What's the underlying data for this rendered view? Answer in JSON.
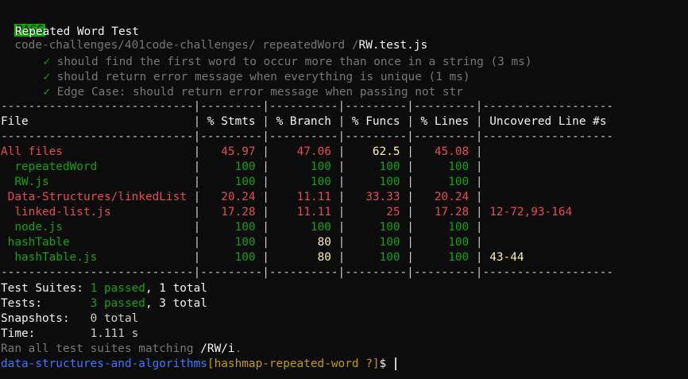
{
  "header": {
    "badge": "PASS",
    "path_dir": "code-challenges/401code-challenges/ repeatedWord /",
    "file": "RW.test.js"
  },
  "suite": {
    "title": "Repeated Word Test",
    "check": "✓",
    "tests": [
      {
        "name": "should find the first word to occur more than once in a string",
        "time": "(3 ms)"
      },
      {
        "name": "should return error message when everything is unique",
        "time": "(1 ms)"
      },
      {
        "name": "Edge Case: should return error message when passing not str",
        "time": ""
      }
    ]
  },
  "coverage": {
    "separator": "----------------------------|---------|----------|---------|---------|-------------------",
    "headers": [
      "File",
      "% Stmts",
      "% Branch",
      "% Funcs",
      "% Lines",
      "Uncovered Line #s"
    ],
    "rows": [
      {
        "file": "All files",
        "indent": 0,
        "stmts": "45.97",
        "branch": "47.06",
        "funcs": "62.5",
        "lines": "45.08",
        "uncovered": "",
        "colors": [
          "red",
          "red",
          "red",
          "yellow",
          "red",
          "red"
        ]
      },
      {
        "file": "repeatedWord",
        "indent": 2,
        "stmts": "100",
        "branch": "100",
        "funcs": "100",
        "lines": "100",
        "uncovered": "",
        "colors": [
          "green",
          "green",
          "green",
          "green",
          "green",
          "green"
        ]
      },
      {
        "file": "RW.js",
        "indent": 2,
        "stmts": "100",
        "branch": "100",
        "funcs": "100",
        "lines": "100",
        "uncovered": "",
        "colors": [
          "green",
          "green",
          "green",
          "green",
          "green",
          "green"
        ]
      },
      {
        "file": "Data-Structures/linkedList",
        "indent": 1,
        "stmts": "20.24",
        "branch": "11.11",
        "funcs": "33.33",
        "lines": "20.24",
        "uncovered": "",
        "colors": [
          "red",
          "red",
          "red",
          "red",
          "red",
          "red"
        ]
      },
      {
        "file": "linked-list.js",
        "indent": 2,
        "stmts": "17.28",
        "branch": "11.11",
        "funcs": "25",
        "lines": "17.28",
        "uncovered": "12-72,93-164",
        "colors": [
          "red",
          "red",
          "red",
          "red",
          "red",
          "red"
        ]
      },
      {
        "file": "node.js",
        "indent": 2,
        "stmts": "100",
        "branch": "100",
        "funcs": "100",
        "lines": "100",
        "uncovered": "",
        "colors": [
          "green",
          "green",
          "green",
          "green",
          "green",
          "green"
        ]
      },
      {
        "file": "hashTable",
        "indent": 1,
        "stmts": "100",
        "branch": "80",
        "funcs": "100",
        "lines": "100",
        "uncovered": "",
        "colors": [
          "green",
          "green",
          "yellow",
          "green",
          "green",
          "green"
        ]
      },
      {
        "file": "hashTable.js",
        "indent": 2,
        "stmts": "100",
        "branch": "80",
        "funcs": "100",
        "lines": "100",
        "uncovered": "43-44",
        "colors": [
          "green",
          "green",
          "yellow",
          "green",
          "green",
          "yellow"
        ]
      }
    ]
  },
  "summary": {
    "suites_label": "Test Suites:",
    "suites_passed": "1 passed",
    "suites_total": ", 1 total",
    "tests_label": "Tests:",
    "tests_passed": "3 passed",
    "tests_total": ", 3 total",
    "snapshots_label": "Snapshots:",
    "snapshots_value": "0 total",
    "time_label": "Time:",
    "time_value": "1.111 s",
    "ran_prefix": "Ran all test suites matching ",
    "ran_pattern": "/RW/i",
    "ran_suffix": "."
  },
  "prompt": {
    "dir": "data-structures-and-algorithms",
    "branch": "[hashmap-repeated-word ?]",
    "symbol": "$"
  },
  "colors": {
    "background": "#0c0c0c",
    "pass_green": "#13a10e",
    "fail_red": "#e74856",
    "warn_yellow": "#f9f1a5",
    "prompt_blue": "#3b78ff",
    "branch_gold": "#c19c00"
  }
}
